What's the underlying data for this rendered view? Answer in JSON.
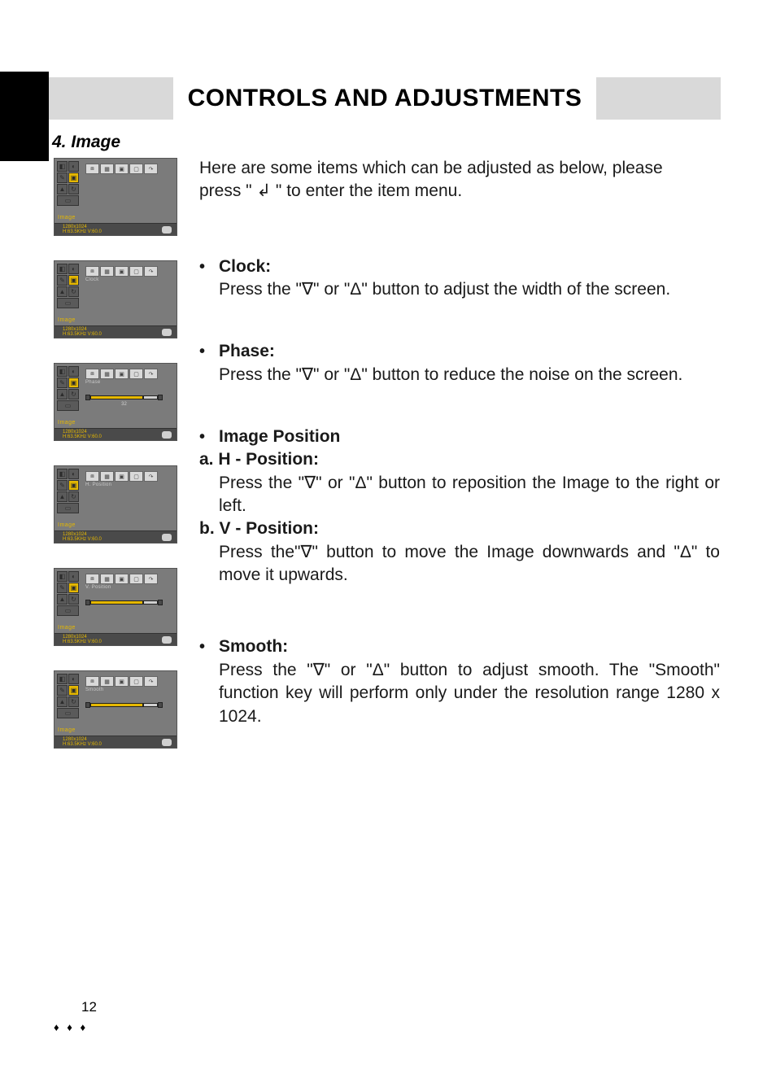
{
  "header": {
    "title": "CONTROLS AND ADJUSTMENTS"
  },
  "section": {
    "number": "4.",
    "name": "Image"
  },
  "intro": {
    "line1": "Here are some items which can be adjusted as below, please",
    "line2_a": "press \" ",
    "enter_symbol": "↲",
    "line2_b": " \" to enter the item menu."
  },
  "osd_common": {
    "resolution": "1280x1024",
    "freq": "H:63.5KHz V:60.0",
    "category": "Image"
  },
  "osd_panels": [
    {
      "sublabel": "",
      "show_slider": false,
      "slider_label": ""
    },
    {
      "sublabel": "Clock",
      "show_slider": false,
      "slider_label": ""
    },
    {
      "sublabel": "Phase",
      "show_slider": true,
      "slider_label": "32"
    },
    {
      "sublabel": "H. Position",
      "show_slider": false,
      "slider_label": ""
    },
    {
      "sublabel": "V. Position",
      "show_slider": true,
      "slider_label": ""
    },
    {
      "sublabel": "Smooth",
      "show_slider": true,
      "slider_label": ""
    }
  ],
  "items": {
    "clock": {
      "title": "Clock:",
      "body": "Press the \"∇\" or \"Δ\" button to adjust the width of  the screen."
    },
    "phase": {
      "title": "Phase:",
      "body": "Press the \"∇\" or \"Δ\" button to reduce the noise on the screen."
    },
    "imgpos": {
      "title": "Image Position",
      "a_head": "a. H - Position:",
      "a_body": "Press the \"∇\" or \"Δ\" button to reposition the Image to the right or left.",
      "b_head": "b. V - Position:",
      "b_body": "Press the\"∇\" button to move the Image downwards and \"Δ\" to move it upwards."
    },
    "smooth": {
      "title": "Smooth:",
      "body": "Press the \"∇\" or \"Δ\" button to adjust smooth. The \"Smooth\" function key will perform only under the resolution range 1280 x 1024."
    }
  },
  "page": {
    "number": "12",
    "diamonds": "♦ ♦ ♦"
  }
}
